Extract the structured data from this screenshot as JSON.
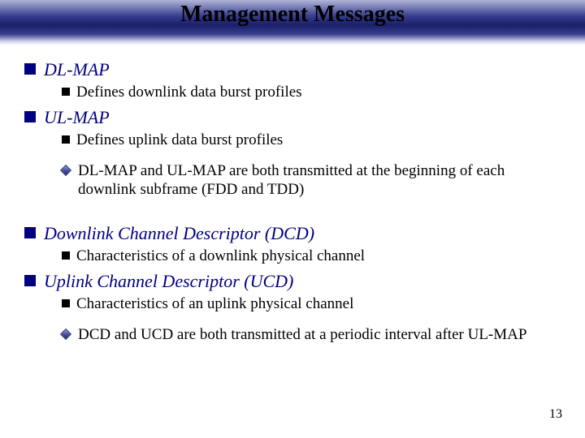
{
  "title": "Management Messages",
  "items": [
    {
      "level": "lvl1",
      "text": "DL-MAP"
    },
    {
      "level": "lvl2",
      "text": "Defines downlink data burst profiles"
    },
    {
      "level": "lvl1",
      "text": "UL-MAP"
    },
    {
      "level": "lvl2",
      "text": "Defines uplink data burst profiles"
    },
    {
      "level": "lvl2b",
      "text": "DL-MAP and UL-MAP are both transmitted at the beginning of each downlink subframe (FDD and TDD)"
    },
    {
      "level": "gap"
    },
    {
      "level": "lvl1",
      "text": "Downlink Channel Descriptor (DCD)"
    },
    {
      "level": "lvl2",
      "text": "Characteristics of a downlink physical channel"
    },
    {
      "level": "lvl1",
      "text": "Uplink Channel Descriptor (UCD)"
    },
    {
      "level": "lvl2",
      "text": "Characteristics of an uplink physical channel"
    },
    {
      "level": "lvl2b",
      "text": "DCD and UCD are both transmitted at a periodic interval after UL-MAP"
    }
  ],
  "page_number": "13"
}
